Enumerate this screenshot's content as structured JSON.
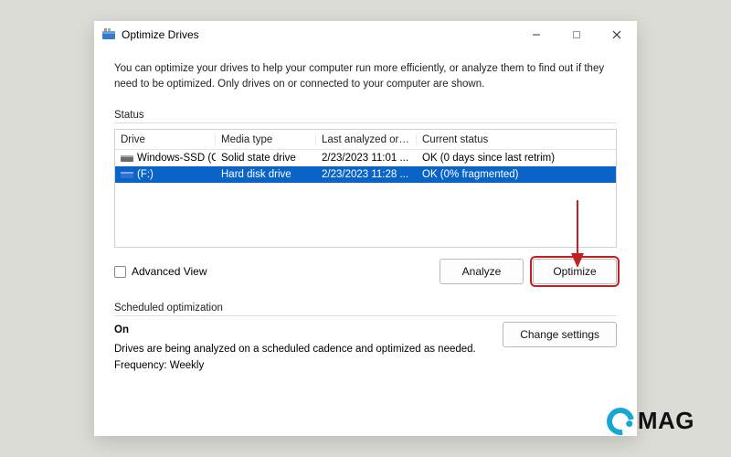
{
  "window": {
    "title": "Optimize Drives"
  },
  "description": "You can optimize your drives to help your computer run more efficiently, or analyze them to find out if they need to be optimized. Only drives on or connected to your computer are shown.",
  "status": {
    "label": "Status",
    "columns": {
      "drive": "Drive",
      "media": "Media type",
      "last": "Last analyzed or ...",
      "current": "Current status"
    },
    "rows": [
      {
        "drive": "Windows-SSD (C:)",
        "media": "Solid state drive",
        "last": "2/23/2023 11:01 ...",
        "current": "OK (0 days since last retrim)",
        "selected": false,
        "iconColor": "#6b6b6b"
      },
      {
        "drive": "(F:)",
        "media": "Hard disk drive",
        "last": "2/23/2023 11:28 ...",
        "current": "OK (0% fragmented)",
        "selected": true,
        "iconColor": "#2f6fd6"
      }
    ]
  },
  "advanced_view": {
    "label": "Advanced View",
    "checked": false
  },
  "buttons": {
    "analyze": "Analyze",
    "optimize": "Optimize",
    "change_settings": "Change settings"
  },
  "scheduled": {
    "label": "Scheduled optimization",
    "on_label": "On",
    "description": "Drives are being analyzed on a scheduled cadence and optimized as needed.",
    "frequency": "Frequency: Weekly"
  },
  "watermark": "MAG"
}
